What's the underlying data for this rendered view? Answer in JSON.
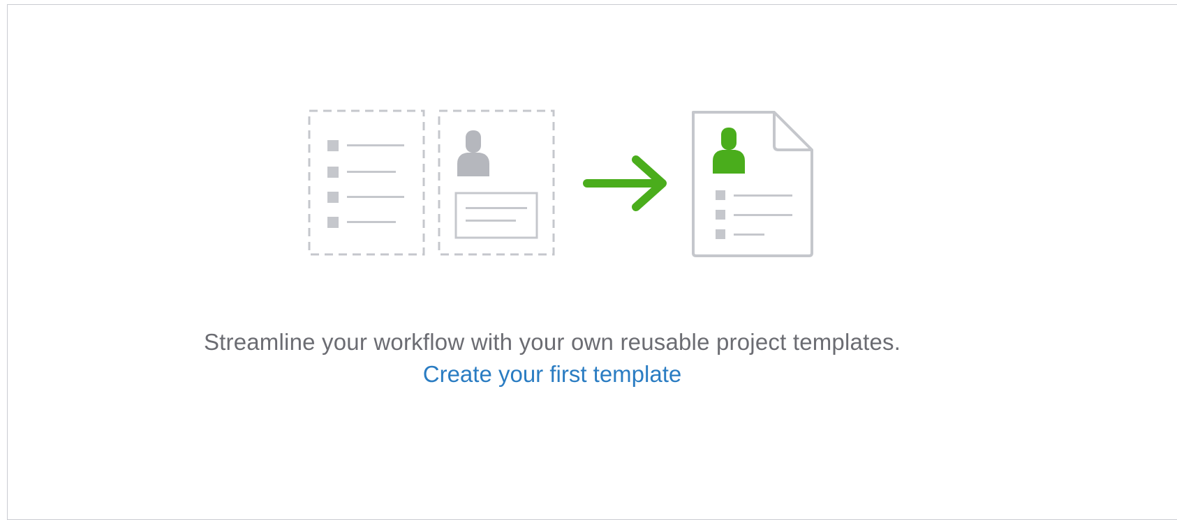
{
  "empty_state": {
    "message": "Streamline your workflow with your own reusable project templates.",
    "cta_label": "Create your first template"
  },
  "colors": {
    "border": "#c9cbd1",
    "placeholder_gray": "#c5c7cc",
    "icon_gray": "#b5b7bd",
    "accent_green": "#4aad1c",
    "link_blue": "#2a7cc2",
    "text_gray": "#6b6c72"
  },
  "icons": {
    "list_placeholder": "dashed-list-document-icon",
    "profile_placeholder": "dashed-profile-document-icon",
    "arrow": "arrow-right-icon",
    "template_document": "template-document-icon"
  }
}
